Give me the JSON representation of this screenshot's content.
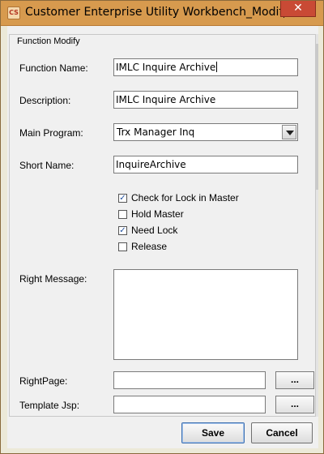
{
  "window": {
    "title": "Customer Enterprise Utility Workbench_Modify F...",
    "icon_text": "CS",
    "close_label": "✕"
  },
  "panel": {
    "title": "Function Modify"
  },
  "form": {
    "function_name": {
      "label": "Function Name:",
      "value": "IMLC Inquire Archive"
    },
    "description": {
      "label": "Description:",
      "value": "IMLC Inquire Archive"
    },
    "main_program": {
      "label": "Main Program:",
      "value": "Trx Manager Inq"
    },
    "short_name": {
      "label": "Short Name:",
      "value": "InquireArchive"
    },
    "checkboxes": [
      {
        "label": "Check for Lock in Master",
        "checked": true
      },
      {
        "label": "Hold Master",
        "checked": false
      },
      {
        "label": "Need Lock",
        "checked": true
      },
      {
        "label": "Release",
        "checked": false
      }
    ],
    "right_message": {
      "label": "Right Message:",
      "value": ""
    },
    "right_page": {
      "label": "RightPage:",
      "value": "",
      "browse_label": "..."
    },
    "template_jsp": {
      "label": "Template Jsp:",
      "value": "",
      "browse_label": "..."
    }
  },
  "buttons": {
    "save": "Save",
    "cancel": "Cancel"
  },
  "check_mark": "✓"
}
